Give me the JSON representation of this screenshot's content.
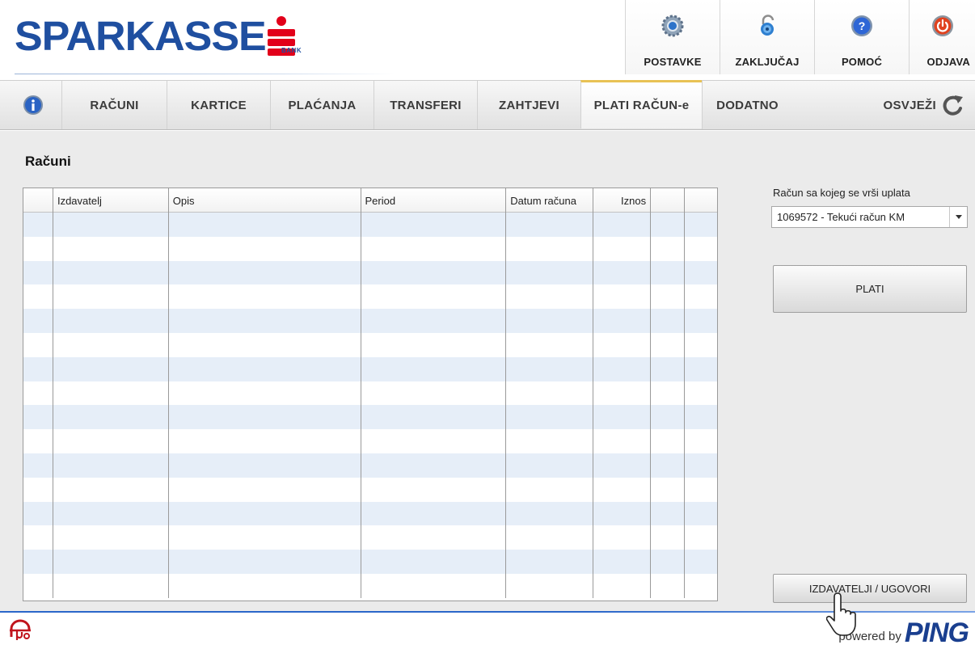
{
  "brand": {
    "name": "SPARKASSE",
    "sub": "BANK"
  },
  "top_actions": [
    {
      "label": "POSTAVKE",
      "icon": "settings-gear-icon"
    },
    {
      "label": "ZAKLJUČAJ",
      "icon": "lock-icon"
    },
    {
      "label": "POMOĆ",
      "icon": "help-icon"
    },
    {
      "label": "ODJAVA",
      "icon": "power-icon"
    }
  ],
  "nav": {
    "info_icon": "info-icon",
    "items": [
      {
        "label": "RAČUNI",
        "active": false
      },
      {
        "label": "KARTICE",
        "active": false
      },
      {
        "label": "PLAĆANJA",
        "active": false
      },
      {
        "label": "TRANSFERI",
        "active": false
      },
      {
        "label": "ZAHTJEVI",
        "active": false
      },
      {
        "label": "PLATI RAČUN-e",
        "active": true
      },
      {
        "label": "DODATNO",
        "active": false
      }
    ],
    "refresh_label": "OSVJEŽI",
    "refresh_icon": "refresh-icon"
  },
  "main": {
    "title": "Računi",
    "table": {
      "columns": [
        "",
        "Izdavatelj",
        "Opis",
        "Period",
        "Datum računa",
        "Iznos",
        "",
        ""
      ],
      "rows": []
    }
  },
  "side": {
    "account_label": "Račun sa kojeg se vrši uplata",
    "account_selected": "1069572 - Tekući račun KM",
    "pay_button": "PLATI",
    "issuers_button": "IZDAVATELJI / UGOVORI"
  },
  "footer": {
    "powered_by": "powered by",
    "ping": "PING"
  },
  "colors": {
    "brand_blue": "#1f4fa0",
    "brand_red": "#e2001a",
    "active_tab_accent": "#e8c255",
    "row_stripe": "#e6eef8"
  }
}
